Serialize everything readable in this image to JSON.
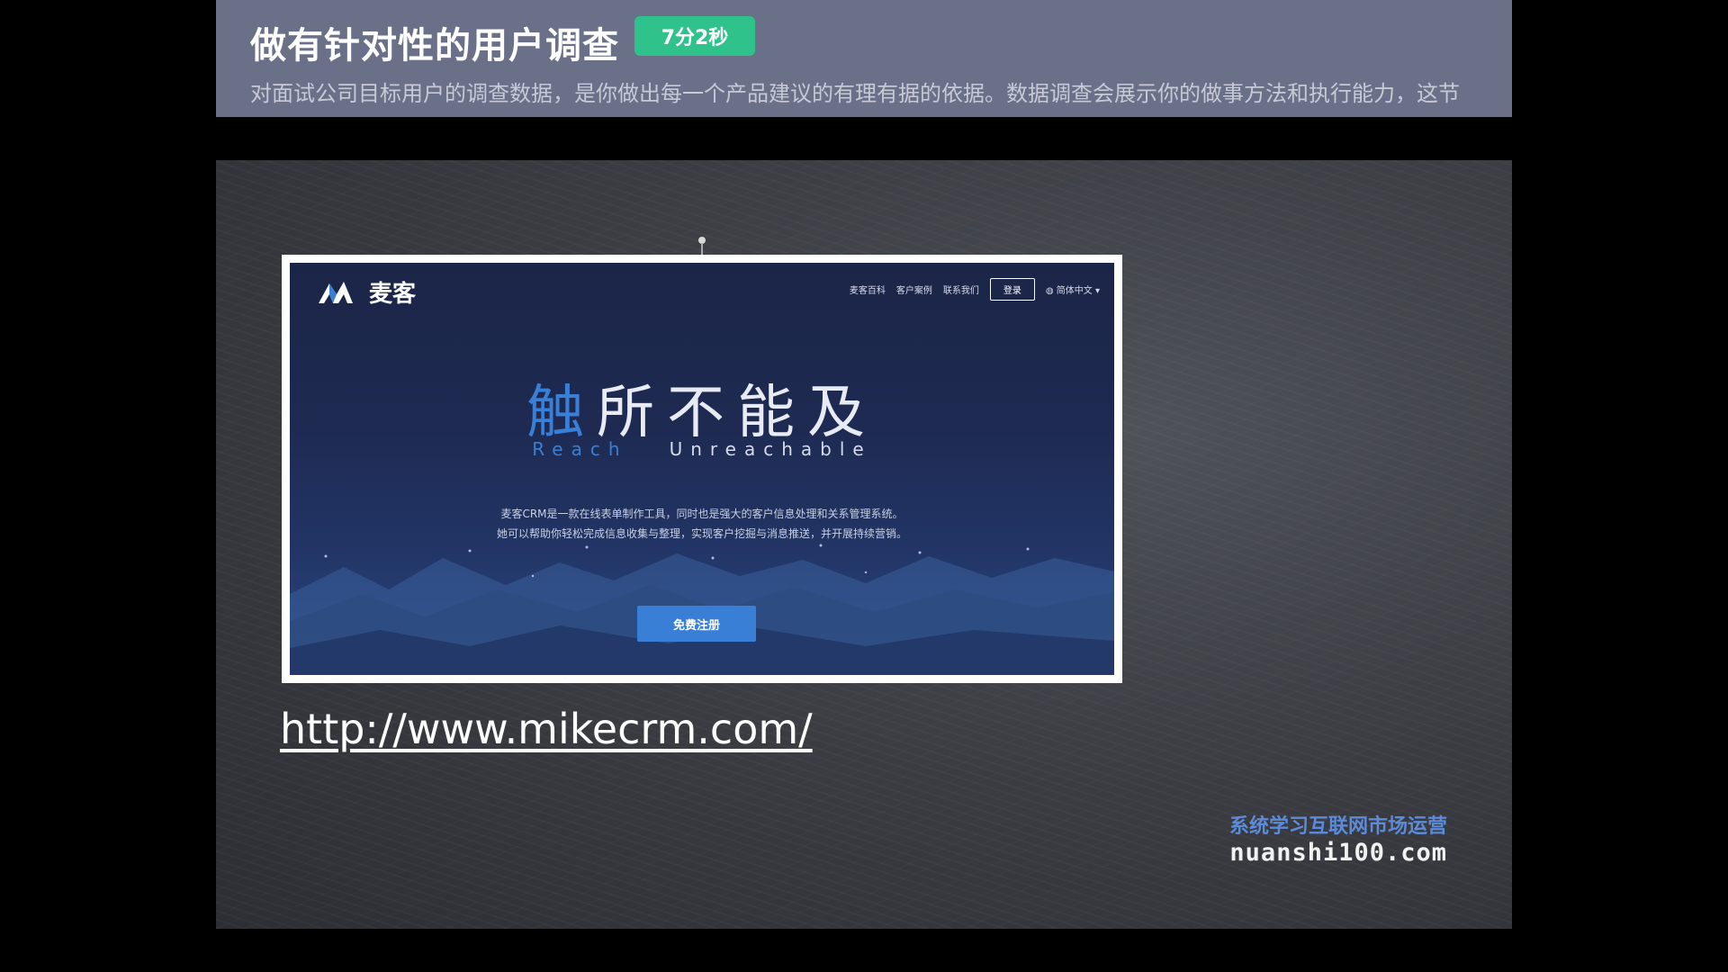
{
  "header": {
    "title": "做有针对性的用户调查",
    "duration": "7分2秒",
    "description": "对面试公司目标用户的调查数据，是你做出每一个产品建议的有理有据的依据。数据调查会展示你的做事方法和执行能力，这节"
  },
  "slide": {
    "website": {
      "logo_text": "麦客",
      "nav": [
        "麦客百科",
        "客户案例",
        "联系我们"
      ],
      "login_label": "登录",
      "language": "简体中文",
      "hero_title_highlight": "触",
      "hero_title_rest": "所不能及",
      "hero_subtitle_highlight": "Reach",
      "hero_subtitle_rest": "Unreachable",
      "description_line1": "麦客CRM是一款在线表单制作工具，同时也是强大的客户信息处理和关系管理系统。",
      "description_line2": "她可以帮助你轻松完成信息收集与整理，实现客户挖掘与消息推送，并开展持续营销。",
      "signup_label": "免费注册"
    },
    "url": "http://www.mikecrm.com/",
    "watermark_cn": "系统学习互联网市场运营",
    "watermark_en": "nuanshi100.com"
  },
  "colors": {
    "header_bg": "#6a7088",
    "badge_bg": "#2fc38b",
    "accent_blue": "#3a7fd6",
    "watermark_blue": "#5b8bd9"
  }
}
